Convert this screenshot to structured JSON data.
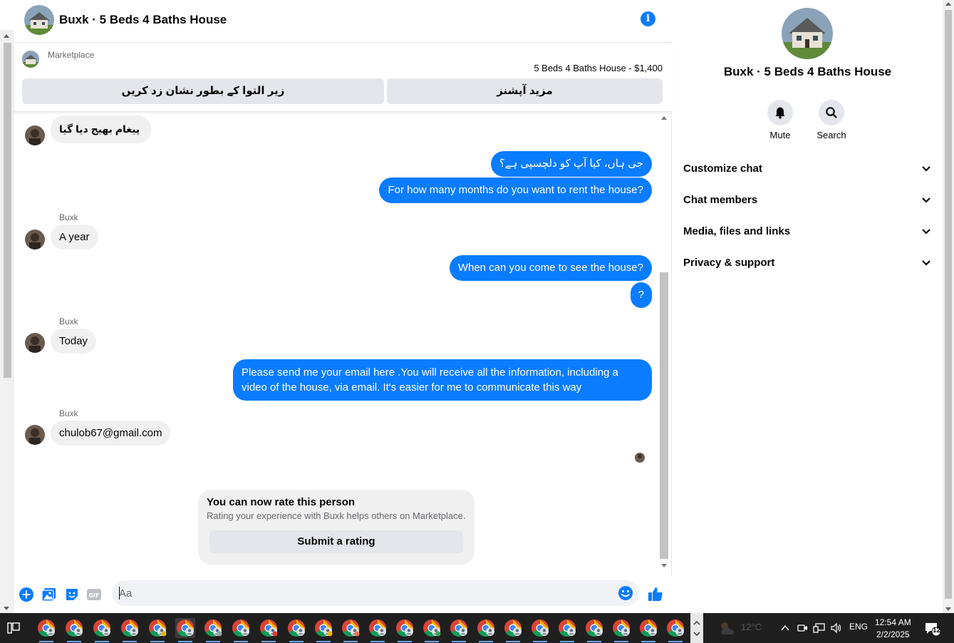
{
  "chat": {
    "title": "Buxk · 5 Beds 4 Baths House",
    "marketplace_label": "Marketplace",
    "listing_price": "5 Beds 4 Baths House - $1,400",
    "btn_mark_pending": "زیر التوا کے بطور نشان زد کریں",
    "btn_more_options": "مزید آپشنز"
  },
  "messages": {
    "m1": "پیغام بھیج دیا گیا",
    "m2": "جی ہاں، کیا آپ کو دلچسپی ہے؟",
    "m3": "For how many months do you want to rent the house?",
    "sender": "Buxk",
    "m4": "A year",
    "m5": "When can you come to see the house?",
    "m6": "?",
    "m7": "Today",
    "m8": "Please send me your email here .You will receive all the information, including a video of the house, via email. It's easier for me to communicate this way",
    "m9": "chulob67@gmail.com"
  },
  "rating": {
    "title": "You can now rate this person",
    "subtitle": "Rating your experience with Buxk helps others on Marketplace.",
    "button": "Submit a rating"
  },
  "composer": {
    "placeholder": "Aa"
  },
  "side": {
    "title": "Buxk · 5 Beds 4 Baths House",
    "mute": "Mute",
    "search": "Search",
    "sections": [
      "Customize chat",
      "Chat members",
      "Media, files and links",
      "Privacy & support"
    ]
  },
  "taskbar": {
    "temperature": "12°C",
    "language": "ENG",
    "time": "12:54 AM",
    "date": "2/2/2025",
    "notifications": "12"
  },
  "colors": {
    "accent": "#0a7cff",
    "bubble_in": "#f0f0f0",
    "taskbar": "#1f1f1f"
  }
}
